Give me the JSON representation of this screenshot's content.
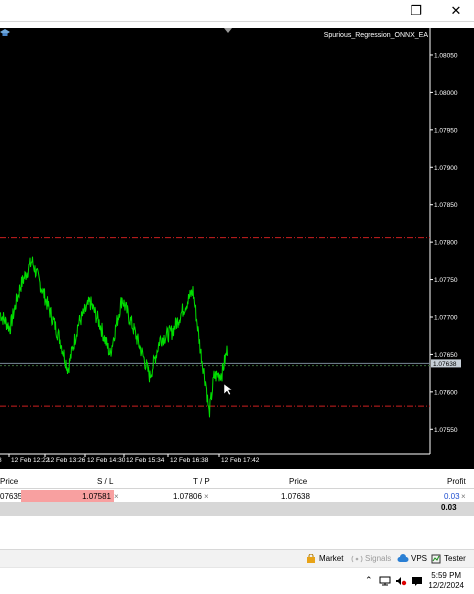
{
  "window": {
    "restore_glyph": "❐",
    "close_glyph": "✕"
  },
  "chart": {
    "ea_label": "Spurious_Regression_ONNX_EA",
    "price_labels": [
      "1.08050",
      "1.08000",
      "1.07950",
      "1.07900",
      "1.07850",
      "1.07800",
      "1.07750",
      "1.07700",
      "1.07650",
      "1.07600",
      "1.07550"
    ],
    "price_label_values": [
      1.0805,
      1.08,
      1.0795,
      1.079,
      1.0785,
      1.078,
      1.0775,
      1.077,
      1.0765,
      1.076,
      1.0755
    ],
    "current_price_label": "1.07638",
    "current_price": 1.07638,
    "tp_level": 1.07806,
    "sl_level": 1.07581,
    "entry_level": 1.07635,
    "y_range": [
      1.07525,
      1.0807
    ],
    "time_labels": [
      "12 Feb 12:22",
      "12 Feb 13:26",
      "12 Feb 14:30",
      "12 Feb 15:34",
      "12 Feb 16:38",
      "12 Feb 17:42"
    ],
    "time_label_prefix": "8",
    "colors": {
      "background": "#000000",
      "price_line": "#00dd00",
      "stop_lines": "#cc1f1f",
      "bid_line": "#7a8a9a",
      "axis_text": "#ffffff",
      "current_price_bg": "#c8d0d8"
    }
  },
  "trade_table": {
    "headers": {
      "price_left": "Price",
      "sl": "S / L",
      "tp": "T / P",
      "price_right": "Price",
      "profit": "Profit"
    },
    "row": {
      "open_price": "07635",
      "sl": "1.07581",
      "tp": "1.07806",
      "current_price": "1.07638",
      "profit": "0.03",
      "close_glyph": "×"
    },
    "total_profit": "0.03",
    "colors": {
      "sl_cell": "#f8a0a0",
      "profit_text": "#1f4fd0"
    }
  },
  "bottom_bar": {
    "market_label": "Market",
    "signals_label": "Signals",
    "vps_label": "VPS",
    "tester_label": "Tester"
  },
  "taskbar": {
    "time": "5:59 PM",
    "date": "12/2/2024"
  }
}
